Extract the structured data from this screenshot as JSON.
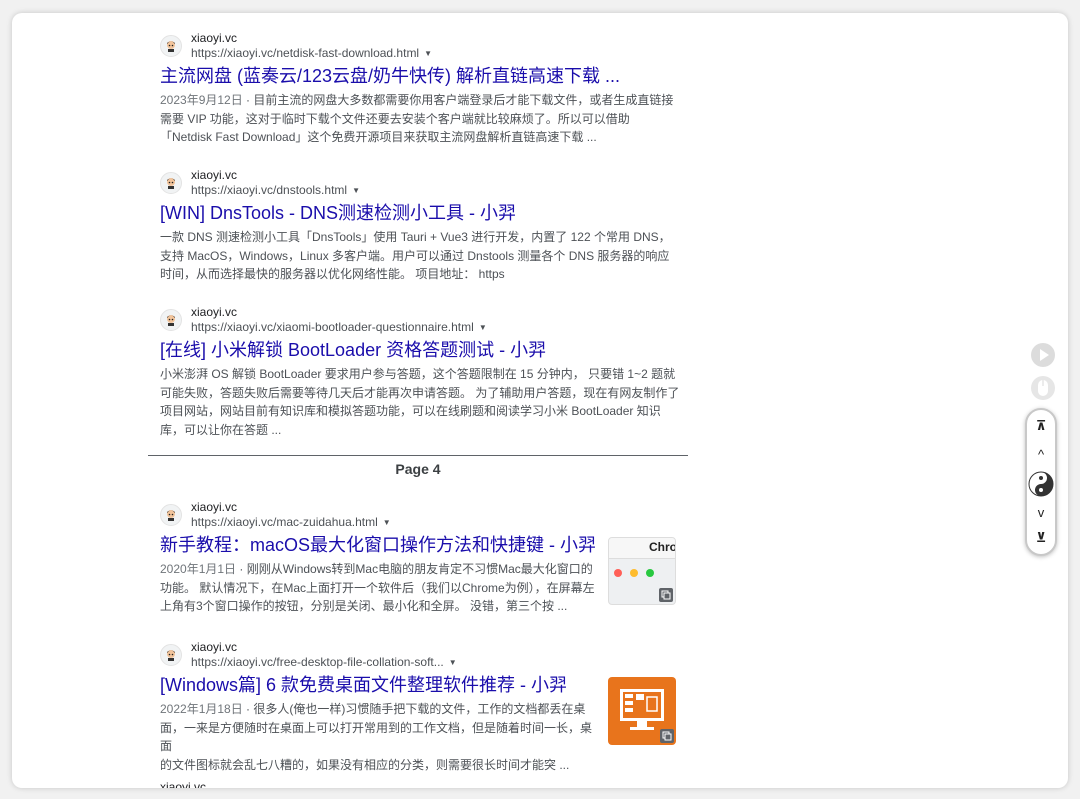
{
  "results_before": [
    {
      "site": "xiaoyi.vc",
      "url": "https://xiaoyi.vc/netdisk-fast-download.html",
      "title": "主流网盘 (蓝奏云/123云盘/奶牛快传) 解析直链高速下载 ...",
      "date": "2023年9月12日",
      "lines": [
        "目前主流的网盘大多数都需要你用客户端登录后才能下载文件，或者生成直链接",
        "需要 VIP 功能，这对于临时下载个文件还要去安装个客户端就比较麻烦了。所以可以借助",
        "「Netdisk Fast Download」这个免费开源项目来获取主流网盘解析直链高速下载 ..."
      ]
    },
    {
      "site": "xiaoyi.vc",
      "url": "https://xiaoyi.vc/dnstools.html",
      "title": "[WIN] DnsTools - DNS测速检测小工具 - 小羿",
      "date": "",
      "lines": [
        "一款 DNS 测速检测小工具「DnsTools」使用 Tauri + Vue3 进行开发，内置了 122 个常用 DNS，",
        "支持 MacOS，Windows，Linux 多客户端。用户可以通过 Dnstools 测量各个 DNS 服务器的响应",
        "时间，从而选择最快的服务器以优化网络性能。 项目地址： https"
      ]
    },
    {
      "site": "xiaoyi.vc",
      "url": "https://xiaoyi.vc/xiaomi-bootloader-questionnaire.html",
      "title": "[在线] 小米解锁 BootLoader 资格答题测试 - 小羿",
      "date": "",
      "lines": [
        "小米澎湃 OS 解锁 BootLoader 要求用户参与答题，这个答题限制在 15 分钟内， 只要错 1~2 题就",
        "可能失败，答题失败后需要等待几天后才能再次申请答题。 为了辅助用户答题，现在有网友制作了",
        "项目网站，网站目前有知识库和模拟答题功能，可以在线刷题和阅读学习小米 BootLoader 知识",
        "库，可以让你在答题 ..."
      ]
    }
  ],
  "page_label": "Page 4",
  "results_after": [
    {
      "site": "xiaoyi.vc",
      "url": "https://xiaoyi.vc/mac-zuidahua.html",
      "title": "新手教程：macOS最大化窗口操作方法和快捷键 - 小羿",
      "date": "2020年1月1日",
      "lines": [
        "刚刚从Windows转到Mac电脑的朋友肯定不习惯Mac最大化窗口的",
        "功能。 默认情况下，在Mac上面打开一个软件后（我们以Chrome为例），在屏幕左",
        "上角有3个窗口操作的按钮，分别是关闭、最小化和全屏。 没错，第三个按 ..."
      ],
      "thumb_text": "Chro"
    },
    {
      "site": "xiaoyi.vc",
      "url": "https://xiaoyi.vc/free-desktop-file-collation-soft...",
      "title": "[Windows篇] 6 款免费桌面文件整理软件推荐 - 小羿",
      "date": "2022年1月18日",
      "lines": [
        "很多人(俺也一样)习惯随手把下载的文件，工作的文档都丢在桌",
        "面，一来是方便随时在桌面上可以打开常用到的工作文档，但是随着时间一长，桌面",
        "的文件图标就会乱七八糟的，如果没有相应的分类，则需要很长时间才能突 ..."
      ]
    }
  ],
  "cut_off_site": "xiaoyi.vc",
  "controls": {
    "top": "⊼",
    "up": "^",
    "down": "v",
    "bottom": "⊻"
  },
  "colors": {
    "title_link": "#1a0dab",
    "snippet": "#4d5156",
    "thumb_orange": "#e8741c"
  }
}
